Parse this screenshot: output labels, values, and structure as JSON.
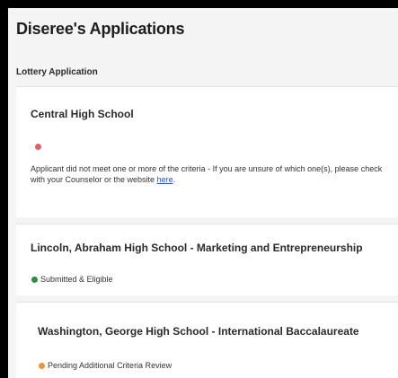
{
  "page": {
    "title": "Diseree's Applications"
  },
  "section": {
    "label": "Lottery Application"
  },
  "applications": [
    {
      "school": "Central High School",
      "status_color": "#e35d6a",
      "status_text": "",
      "message_text": "Applicant did not meet one or more of the criteria - If you are unsure of which one(s), please check with your Counselor or the website ",
      "message_link": "here",
      "message_end": "."
    },
    {
      "school": "Lincoln, Abraham High School - Marketing and Entrepreneurship",
      "status_color": "#2e8b4a",
      "status_text": "Submitted & Eligible"
    },
    {
      "school": "Washington, George High School - International Baccalaureate",
      "status_color": "#f0923a",
      "status_text": "Pending Additional Criteria Review"
    }
  ]
}
